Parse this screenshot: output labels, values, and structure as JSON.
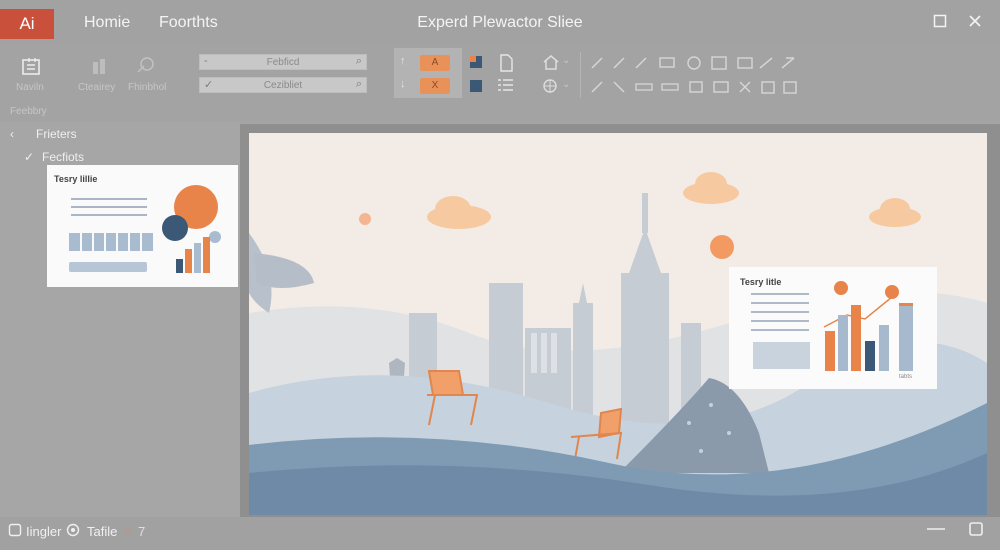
{
  "app": {
    "logo": "Ai",
    "title": "Experd Plewactor Sliee",
    "tabs": [
      "Homie",
      "Foorthts"
    ]
  },
  "ribbon": {
    "group1_label": "Naviln",
    "group1_caption": "Feebbry",
    "tool_labels": [
      "Cteairey",
      "Fhinbhol"
    ],
    "field1": "Febficd",
    "field2": "Cezibliet",
    "chip1": "A",
    "chip2": "X"
  },
  "left_panel": {
    "tree_root": "Frieters",
    "tree_child": "Fecfiots",
    "thumb_title": "Tesry lillie"
  },
  "slide": {
    "card_title": "Tesry litle",
    "card_footer": "tabts"
  },
  "status": {
    "item1": "Iingler",
    "item2": "Tafile",
    "num1": "2",
    "num2": "7"
  },
  "colors": {
    "accent_orange": "#e8844a",
    "chart_blue": "#a7b9cc",
    "navy": "#3b5877",
    "logo_red": "#c9503a"
  }
}
